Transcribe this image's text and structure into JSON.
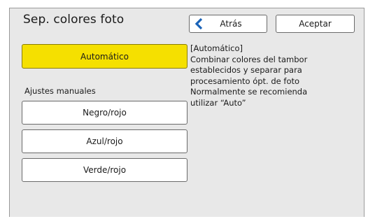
{
  "header": {
    "title": "Sep. colores foto",
    "back_label": "Atrás",
    "ok_label": "Aceptar"
  },
  "modes": {
    "auto_label": "Automático",
    "manual_heading": "Ajustes manuales",
    "manual_options": [
      "Negro/rojo",
      "Azul/rojo",
      "Verde/rojo"
    ],
    "selected": "Automático"
  },
  "description": {
    "lines": [
      "[Automático]",
      "Combinar colores del tambor",
      "establecidos y separar para",
      "procesamiento ópt. de foto",
      "Normalmente se recomienda",
      "utilizar “Auto”"
    ]
  },
  "colors": {
    "accent_selected": "#f5e000",
    "back_chevron": "#1a63b8"
  },
  "icons": {
    "back": "chevron-left-icon"
  }
}
